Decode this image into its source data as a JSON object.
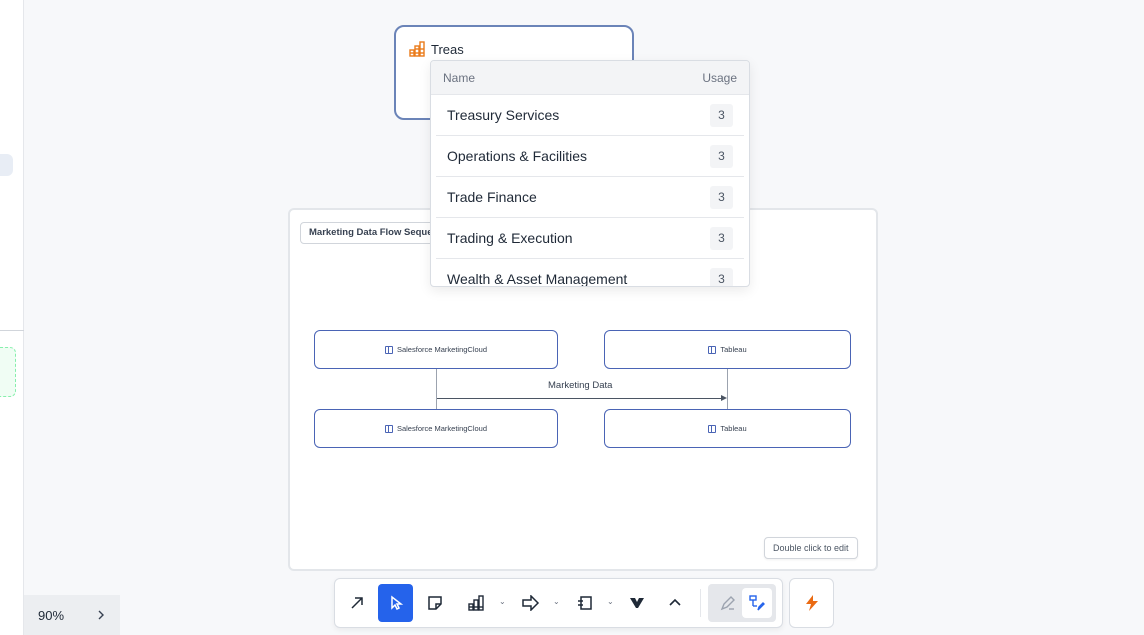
{
  "top_node": {
    "label": "Treas",
    "icon": "bar-chart-icon"
  },
  "frame": {
    "title": "Marketing Data Flow Seque",
    "participants": [
      "Salesforce MarketingCloud",
      "Tableau"
    ],
    "message": "Marketing Data",
    "hint": "Double click to edit"
  },
  "dropdown": {
    "header_name": "Name",
    "header_usage": "Usage",
    "items": [
      {
        "name": "Treasury Services",
        "usage": "3"
      },
      {
        "name": "Operations & Facilities",
        "usage": "3"
      },
      {
        "name": "Trade Finance",
        "usage": "3"
      },
      {
        "name": "Trading & Execution",
        "usage": "3"
      },
      {
        "name": "Wealth & Asset Management",
        "usage": "3"
      }
    ]
  },
  "zoom": {
    "level": "90%"
  },
  "colors": {
    "accent": "#2563eb",
    "node_border": "#4a64b5",
    "brand": "#ea6a12"
  }
}
